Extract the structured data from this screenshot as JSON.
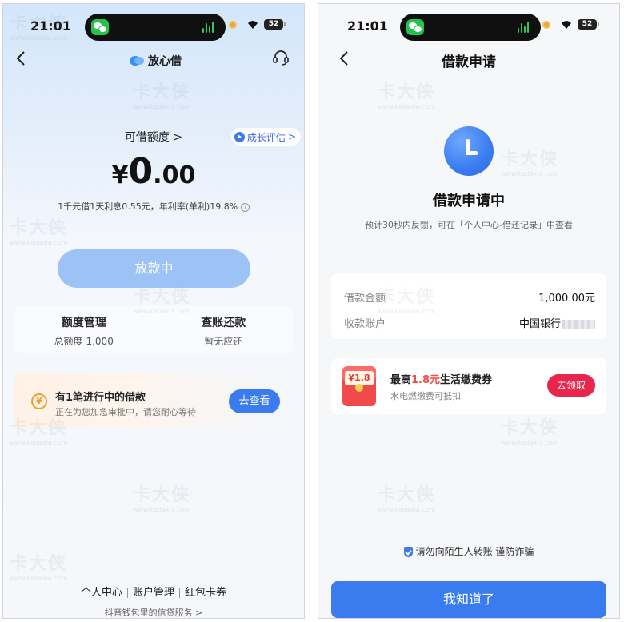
{
  "left": {
    "status": {
      "time": "21:01",
      "battery": "52"
    },
    "nav": {
      "brand": "放心借"
    },
    "quota": {
      "label": "可借额度",
      "chevron": ">",
      "growth_label": "成长评估",
      "growth_chevron": ">"
    },
    "amount": {
      "currency": "¥",
      "integer": "0",
      "decimal": ".00"
    },
    "rate_text": "1千元借1天利息0.55元，年利率(单利)19.8%",
    "loan_button": "放款中",
    "management": [
      {
        "title": "额度管理",
        "sub": "总额度 1,000"
      },
      {
        "title": "查账还款",
        "sub": "暂无应还"
      }
    ],
    "pending": {
      "icon": "¥",
      "title": "有1笔进行中的借款",
      "sub": "正在为您加急审批中，请您耐心等待",
      "button": "去查看"
    },
    "bottom_links": [
      "个人中心",
      "账户管理",
      "红包卡券"
    ],
    "footer": "抖音钱包里的信贷服务 >"
  },
  "right": {
    "status": {
      "time": "21:01",
      "battery": "52"
    },
    "nav": {
      "title": "借款申请"
    },
    "status_title": "借款申请中",
    "status_note": "预计30秒内反馈，可在「个人中心-借还记录」中查看",
    "details": [
      {
        "key": "借款金额",
        "value": "1,000.00元"
      },
      {
        "key": "收款账户",
        "value": "中国银行"
      }
    ],
    "coupon": {
      "badge": "¥1.8",
      "title_prefix": "最高",
      "title_highlight": "1.8元",
      "title_suffix": "生活缴费券",
      "sub": "水电燃缴费可抵扣",
      "button": "去领取"
    },
    "safety_text": "请勿向陌生人转账 谨防诈骗",
    "ok_button": "我知道了"
  },
  "watermark": {
    "text": "卡大侠",
    "url": "www.kadaxia.com"
  },
  "colors": {
    "primary": "#3a7cf0",
    "disabled_button": "#9cc2f6",
    "danger": "#e8264d",
    "highlight": "#f24b4b",
    "wechat": "#24c34f"
  }
}
